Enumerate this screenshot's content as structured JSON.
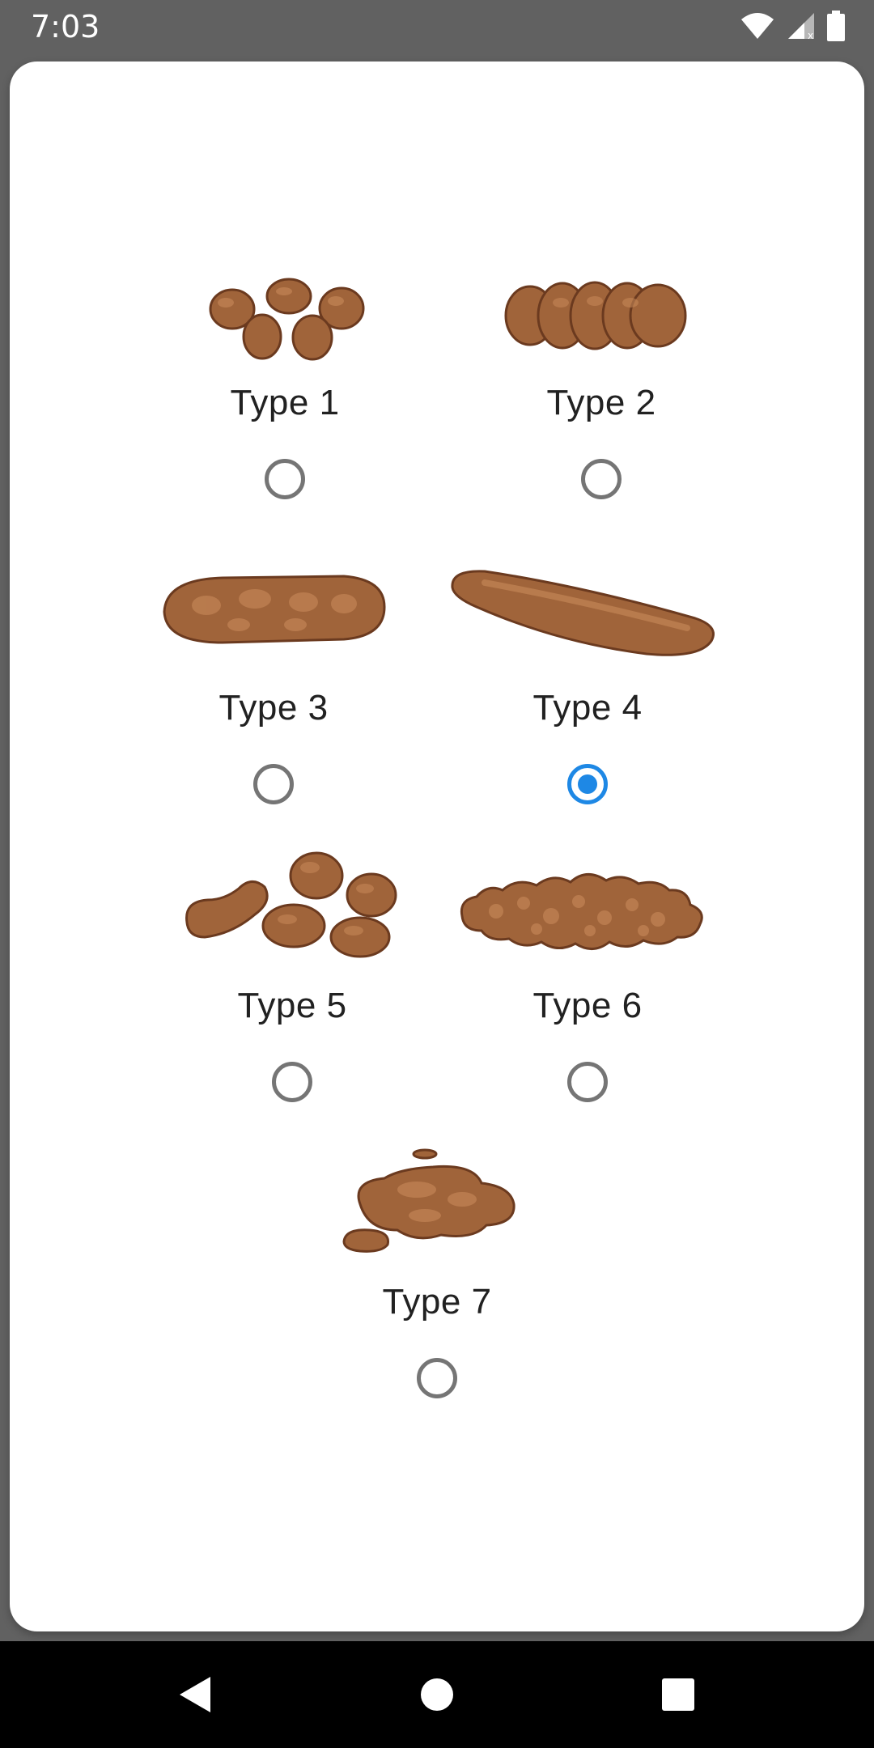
{
  "status_bar": {
    "time": "7:03",
    "icons": [
      "wifi-icon",
      "cellular-signal-icon",
      "battery-icon"
    ]
  },
  "options": [
    {
      "label": "Type 1",
      "selected": false,
      "image": "type-1-stool-image"
    },
    {
      "label": "Type 2",
      "selected": false,
      "image": "type-2-stool-image"
    },
    {
      "label": "Type 3",
      "selected": false,
      "image": "type-3-stool-image"
    },
    {
      "label": "Type 4",
      "selected": true,
      "image": "type-4-stool-image"
    },
    {
      "label": "Type 5",
      "selected": false,
      "image": "type-5-stool-image"
    },
    {
      "label": "Type 6",
      "selected": false,
      "image": "type-6-stool-image"
    },
    {
      "label": "Type 7",
      "selected": false,
      "image": "type-7-stool-image"
    }
  ],
  "nav_bar": {
    "buttons": [
      "back-icon",
      "home-icon",
      "recents-icon"
    ]
  },
  "colors": {
    "accent": "#1e88e5",
    "stool_fill": "#a0643a",
    "stool_outline": "#6b3a1f",
    "status_bar_bg": "#616161",
    "nav_bar_bg": "#000000"
  }
}
